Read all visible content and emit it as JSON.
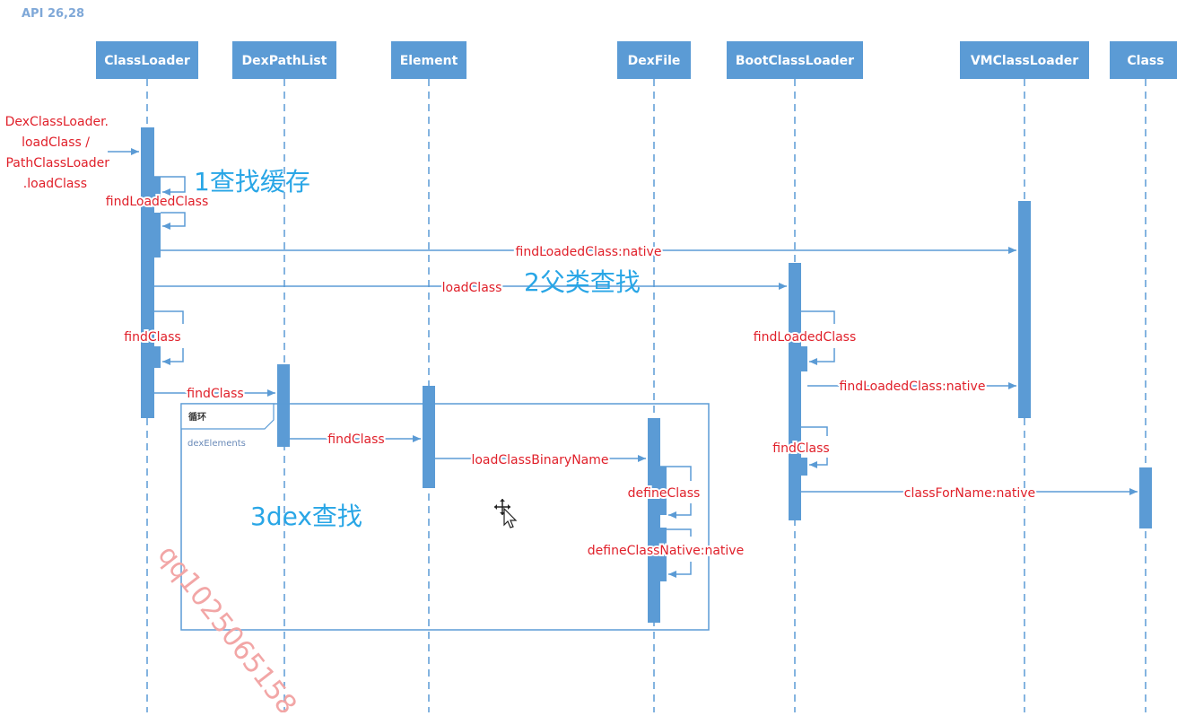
{
  "header": {
    "api_label": "API 26,28"
  },
  "participants": [
    {
      "id": "ClassLoader",
      "label": "ClassLoader"
    },
    {
      "id": "DexPathList",
      "label": "DexPathList"
    },
    {
      "id": "Element",
      "label": "Element"
    },
    {
      "id": "DexFile",
      "label": "DexFile"
    },
    {
      "id": "BootClassLoader",
      "label": "BootClassLoader"
    },
    {
      "id": "VMClassLoader",
      "label": "VMClassLoader"
    },
    {
      "id": "Class",
      "label": "Class"
    }
  ],
  "entry_call": [
    "DexClassLoader.",
    "loadClass /",
    "PathClassLoader",
    ".loadClass"
  ],
  "messages": {
    "findLoadedClass_self": "findLoadedClass",
    "findLoadedClass_native": "findLoadedClass:native",
    "loadClass": "loadClass",
    "findClass_self": "findClass",
    "findClass_to_dexpathlist": "findClass",
    "findClass_to_element": "findClass",
    "loadClassBinaryName": "loadClassBinaryName",
    "defineClass": "defineClass",
    "defineClassNative": "defineClassNative:native",
    "boot_findLoadedClass": "findLoadedClass",
    "boot_findLoadedClass_native": "findLoadedClass:native",
    "boot_findClass": "findClass",
    "classForName": "classForName:native"
  },
  "notes": {
    "step1": "1查找缓存",
    "step2": "2父类查找",
    "step3": "3dex查找"
  },
  "loop": {
    "label": "循环",
    "condition": "dexElements"
  },
  "watermark": "qq1025065158",
  "colors": {
    "box": "#5b9bd5",
    "message": "#e0202a",
    "note": "#29a6e6"
  }
}
